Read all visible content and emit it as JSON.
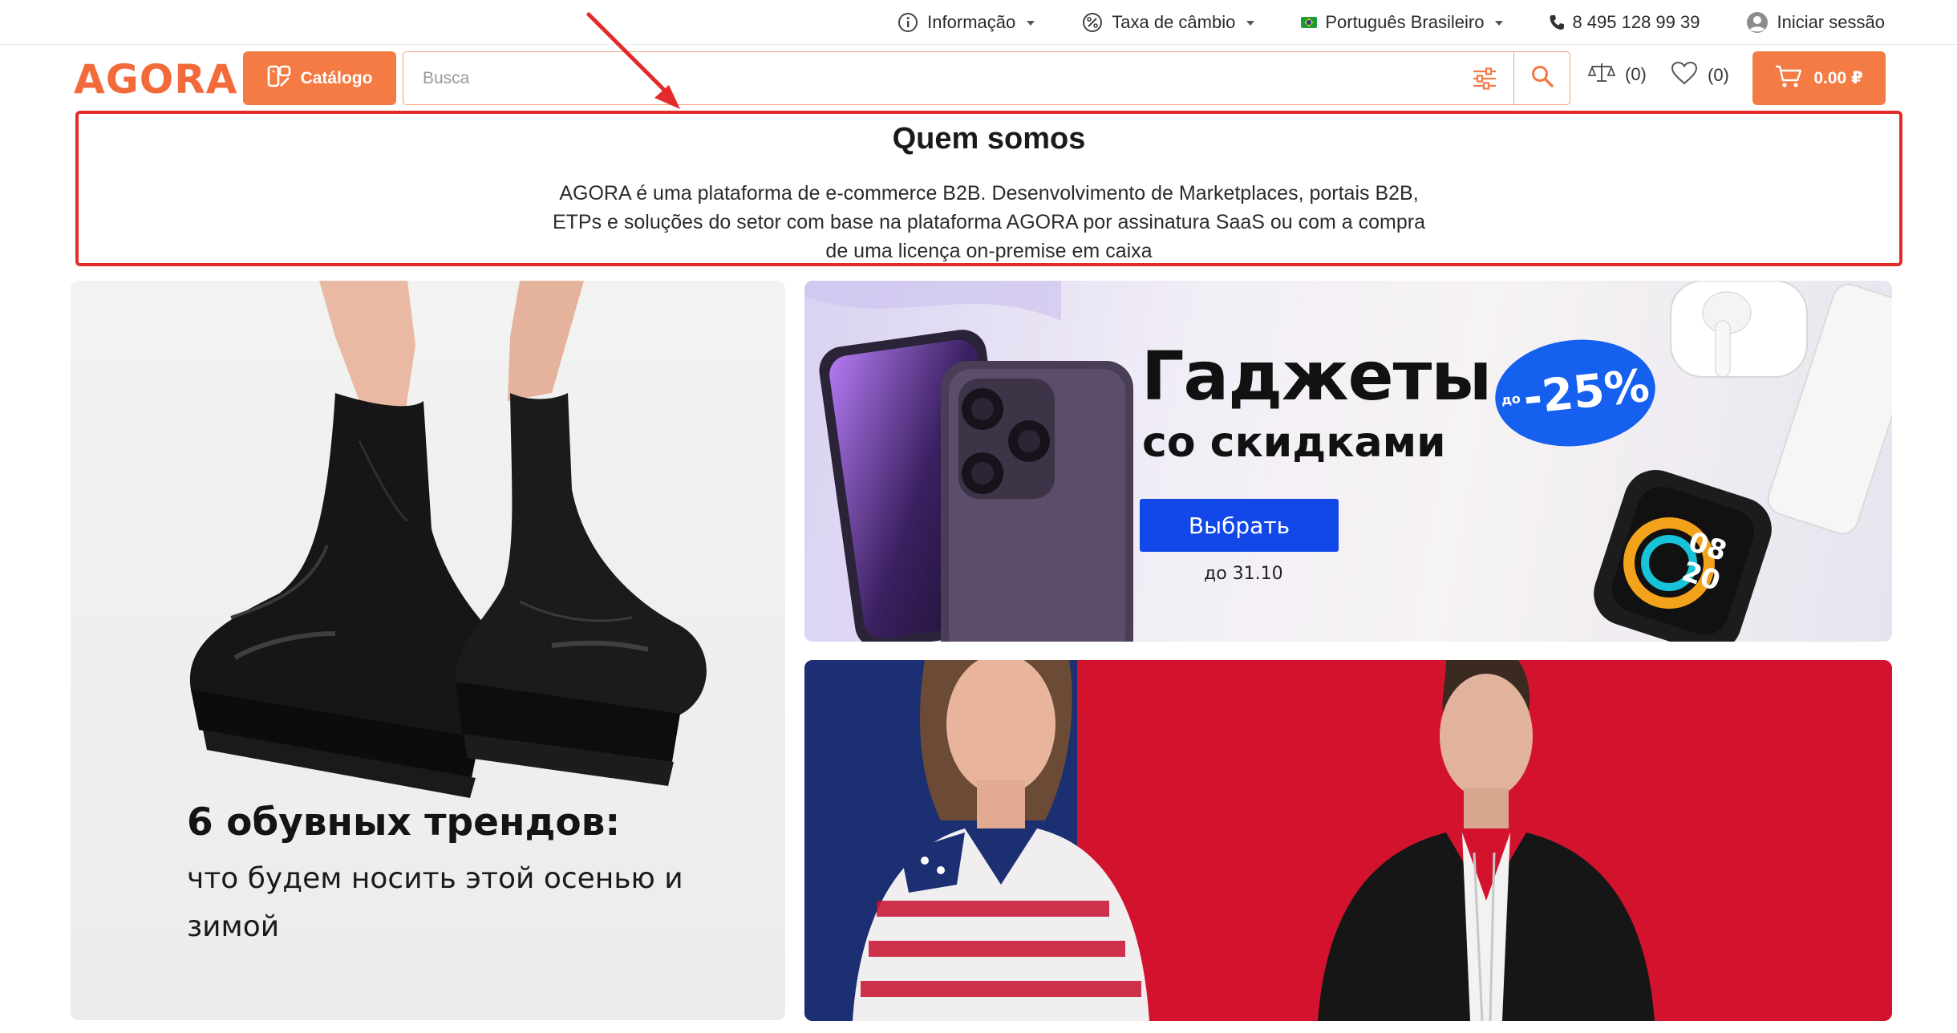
{
  "topbar": {
    "info_label": "Informação",
    "currency_label": "Taxa de câmbio",
    "language_label": "Português Brasileiro",
    "phone": "8 495 128 99 39",
    "login_label": "Iniciar sessão"
  },
  "header": {
    "logo": "AGORA",
    "catalog_label": "Catálogo",
    "search_placeholder": "Busca",
    "compare_count": "(0)",
    "wishlist_count": "(0)",
    "cart_total": "0.00 ₽"
  },
  "about": {
    "title": "Quem somos",
    "text": "AGORA é uma plataforma de e-commerce B2B. Desenvolvimento de Marketplaces, portais B2B, ETPs e soluções do setor com base na plataforma AGORA por assinatura SaaS ou com a compra de uma licença on-premise em caixa"
  },
  "banners": {
    "shoes": {
      "title": "6 обувных трендов:",
      "subtitle": "что будем носить этой осенью и зимой"
    },
    "gadgets": {
      "title": "Гаджеты",
      "subtitle": "со скидками",
      "button": "Выбрать",
      "date": "до 31.10",
      "discount_prefix": "до",
      "discount": "-25%"
    }
  },
  "colors": {
    "accent": "#f47b43",
    "highlight_border": "#e32b2b",
    "gadget_button": "#1348e8",
    "fashion_bg": "#d3132e",
    "fashion_blue": "#1b2f72"
  }
}
